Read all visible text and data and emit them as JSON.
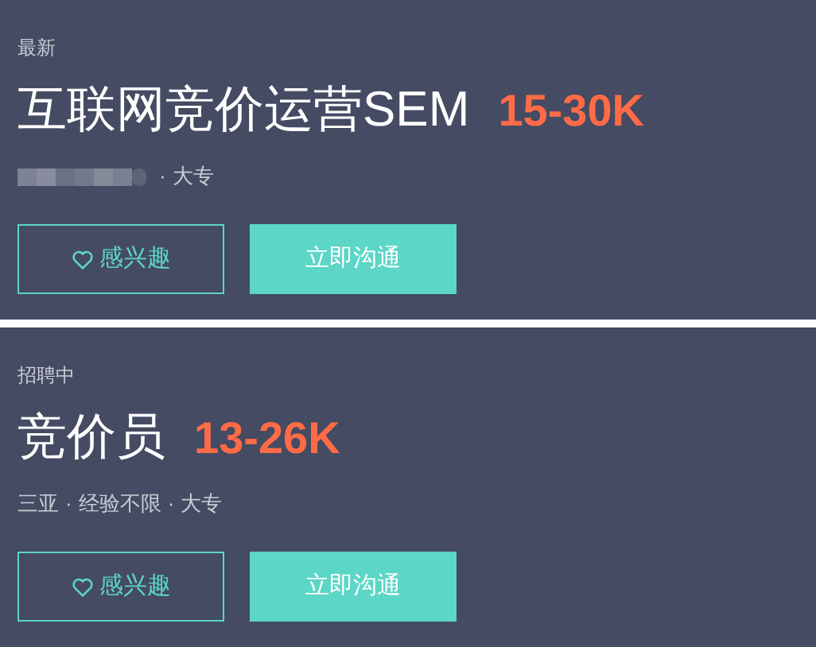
{
  "separator": "·",
  "jobs": [
    {
      "status": "最新",
      "title": "互联网竞价运营SEM",
      "salary": "15-30K",
      "redacted": true,
      "meta": [
        "大专"
      ],
      "interest_button": "感兴趣",
      "chat_button": "立即沟通"
    },
    {
      "status": "招聘中",
      "title": "竞价员",
      "salary": "13-26K",
      "redacted": false,
      "meta": [
        "三亚",
        "经验不限",
        "大专"
      ],
      "interest_button": "感兴趣",
      "chat_button": "立即沟通"
    }
  ]
}
